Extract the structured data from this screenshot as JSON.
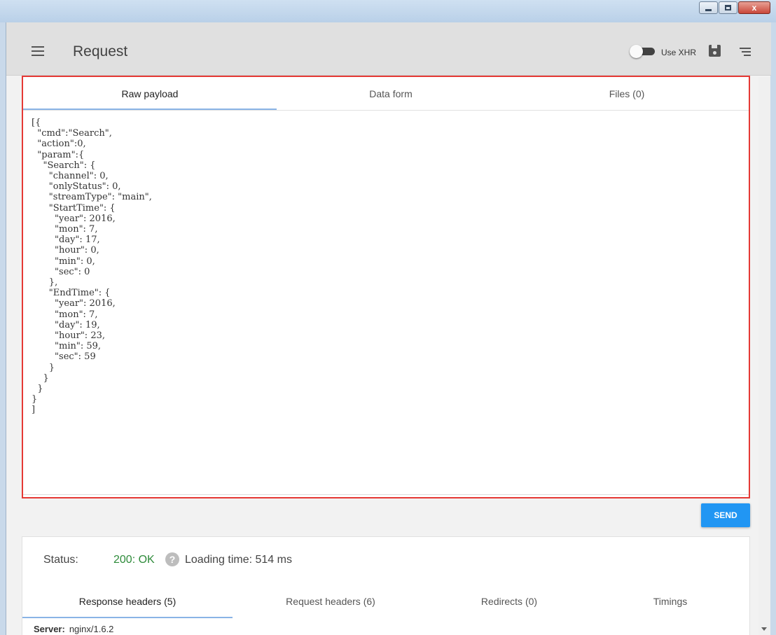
{
  "window": {
    "min_glyph": "",
    "max_glyph": "",
    "close_glyph": "x"
  },
  "header": {
    "title": "Request",
    "xhr_label": "Use XHR",
    "xhr_enabled": false
  },
  "request_tabs": [
    {
      "label": "Raw payload",
      "active": true
    },
    {
      "label": "Data form",
      "active": false
    },
    {
      "label": "Files (0)",
      "active": false
    }
  ],
  "payload_lines": [
    "[{",
    "  \"cmd\":\"Search\",",
    "  \"action\":0,",
    "  \"param\":{",
    "    \"Search\": {",
    "      \"channel\": 0,",
    "      \"onlyStatus\": 0,",
    "      \"streamType\": \"main\",",
    "      \"StartTime\": {",
    "        \"year\": 2016,",
    "        \"mon\": 7,",
    "        \"day\": 17,",
    "        \"hour\": 0,",
    "        \"min\": 0,",
    "        \"sec\": 0",
    "      },",
    "      \"EndTime\": {",
    "        \"year\": 2016,",
    "        \"mon\": 7,",
    "        \"day\": 19,",
    "        \"hour\": 23,",
    "        \"min\": 59,",
    "        \"sec\": 59",
    "      }",
    "    }",
    "  }",
    "}",
    "]"
  ],
  "send_label": "SEND",
  "response": {
    "status_label": "Status:",
    "status_value": "200: OK",
    "help_glyph": "?",
    "loading_text": "Loading time: 514 ms",
    "tabs": [
      {
        "label": "Response headers (5)",
        "active": true
      },
      {
        "label": "Request headers (6)",
        "active": false
      },
      {
        "label": "Redirects (0)",
        "active": false
      },
      {
        "label": "Timings",
        "active": false
      }
    ],
    "first_header": {
      "name": "Server:",
      "value": "nginx/1.6.2"
    }
  },
  "colors": {
    "accent": "#2196f3",
    "highlight_border": "#e53935",
    "status_ok": "#2e8b3a"
  }
}
